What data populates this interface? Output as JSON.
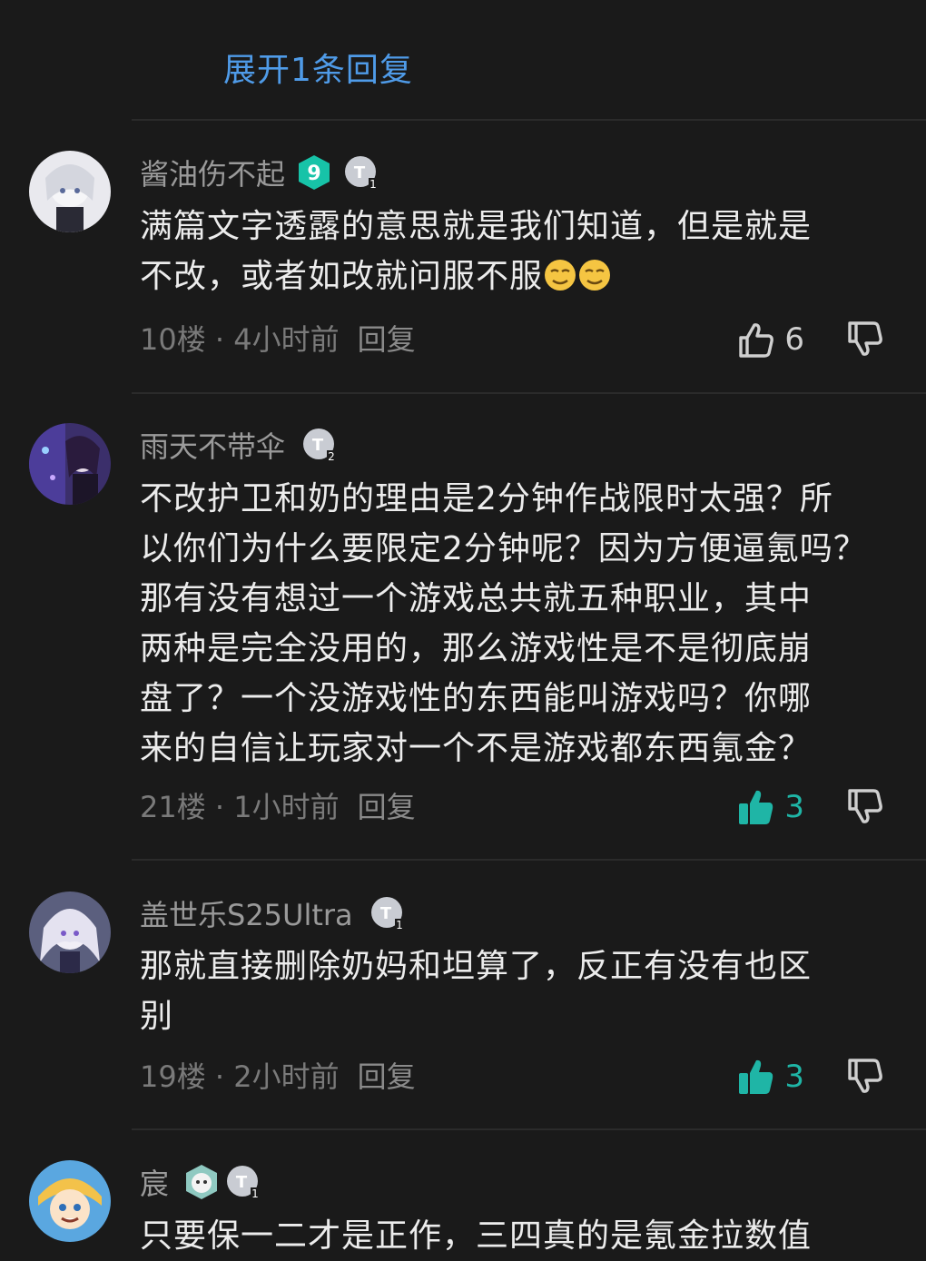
{
  "colors": {
    "background": "#1a1a1a",
    "link": "#4f9be8",
    "like_active": "#1fb5a6",
    "username": "#9a9a9a",
    "meta": "#7a7a7a"
  },
  "expand_link": "展开1条回复",
  "comments": [
    {
      "username": "酱油伤不起",
      "level_badge": "9",
      "title_badge": "T1",
      "body_lines": [
        "满篇文字透露的意思就是我们知道，但是就是",
        "不改，或者如改就问服不服"
      ],
      "emoji": "smirk-face-emoji",
      "floor": "10楼",
      "time": "4小时前",
      "reply_label": "回复",
      "likes": "6",
      "liked": false
    },
    {
      "username": "雨天不带伞",
      "title_badge": "T2",
      "body_lines": [
        "不改护卫和奶的理由是2分钟作战限时太强？所",
        "以你们为什么要限定2分钟呢？因为方便逼氪吗？",
        "那有没有想过一个游戏总共就五种职业，其中",
        "两种是完全没用的，那么游戏性是不是彻底崩",
        "盘了？一个没游戏性的东西能叫游戏吗？你哪",
        "来的自信让玩家对一个不是游戏都东西氪金？"
      ],
      "floor": "21楼",
      "time": "1小时前",
      "reply_label": "回复",
      "likes": "3",
      "liked": true
    },
    {
      "username": "盖世乐S25Ultra",
      "title_badge": "T1",
      "body_lines": [
        "那就直接删除奶妈和坦算了，反正有没有也区",
        "别"
      ],
      "floor": "19楼",
      "time": "2小时前",
      "reply_label": "回复",
      "likes": "3",
      "liked": true
    },
    {
      "username": "宸",
      "title_badge": "T1",
      "body_lines": [
        "只要保一二才是正作，三四真的是氪金拉数值"
      ]
    }
  ],
  "meta_separator": " · "
}
